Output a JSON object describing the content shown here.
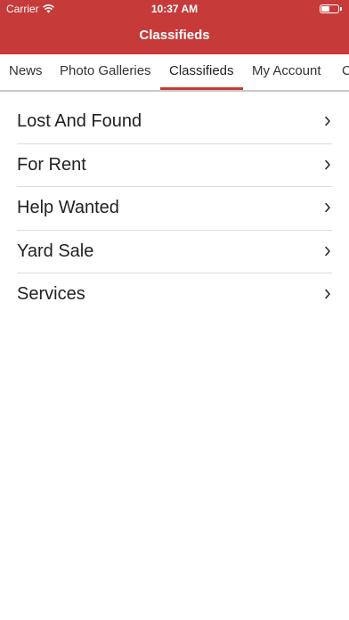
{
  "status_bar": {
    "carrier": "Carrier",
    "time": "10:37 AM"
  },
  "nav": {
    "title": "Classifieds"
  },
  "tabs": [
    {
      "label": "News"
    },
    {
      "label": "Photo Galleries"
    },
    {
      "label": "Classifieds",
      "active": true
    },
    {
      "label": "My Account"
    },
    {
      "label": "C"
    }
  ],
  "list": {
    "items": [
      {
        "label": "Lost And Found"
      },
      {
        "label": "For Rent"
      },
      {
        "label": "Help Wanted"
      },
      {
        "label": "Yard Sale"
      },
      {
        "label": "Services"
      }
    ]
  },
  "colors": {
    "accent": "#c73a3a"
  }
}
